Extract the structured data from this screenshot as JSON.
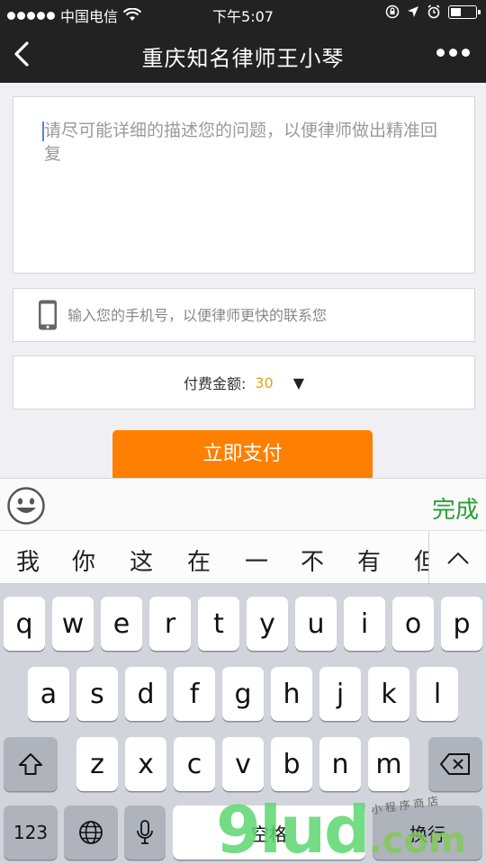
{
  "status_bar": {
    "carrier": "中国电信",
    "time": "下午5:07"
  },
  "nav": {
    "title": "重庆知名律师王小琴",
    "icons": [
      "chevron-left-icon",
      "more-icon"
    ]
  },
  "form": {
    "question_placeholder": "请尽可能详细的描述您的问题，以便律师做出精准回复",
    "phone_placeholder": "输入您的手机号，以便律师更快的联系您",
    "fee_label": "付费金额:",
    "fee_amount": "30",
    "fee_dropdown": "▼",
    "pay_button": "立即支付"
  },
  "keyboard_toolbar": {
    "done_label": "完成"
  },
  "candidates": [
    "我",
    "你",
    "这",
    "在",
    "一",
    "不",
    "有",
    "但"
  ],
  "keyboard": {
    "row1": [
      "q",
      "w",
      "e",
      "r",
      "t",
      "y",
      "u",
      "i",
      "o",
      "p"
    ],
    "row2": [
      "a",
      "s",
      "d",
      "f",
      "g",
      "h",
      "j",
      "k",
      "l"
    ],
    "row3": [
      "z",
      "x",
      "c",
      "v",
      "b",
      "n",
      "m"
    ],
    "numbers_key": "123",
    "space_key": "空格",
    "return_key": "换行"
  },
  "watermark": {
    "main": "9lud",
    "suffix": ".com",
    "note": "小 程 序 商 店"
  },
  "colors": {
    "accent": "#ff7f00",
    "amount": "#e6a11c",
    "done": "#2aa035",
    "nav_bg": "#222222"
  }
}
